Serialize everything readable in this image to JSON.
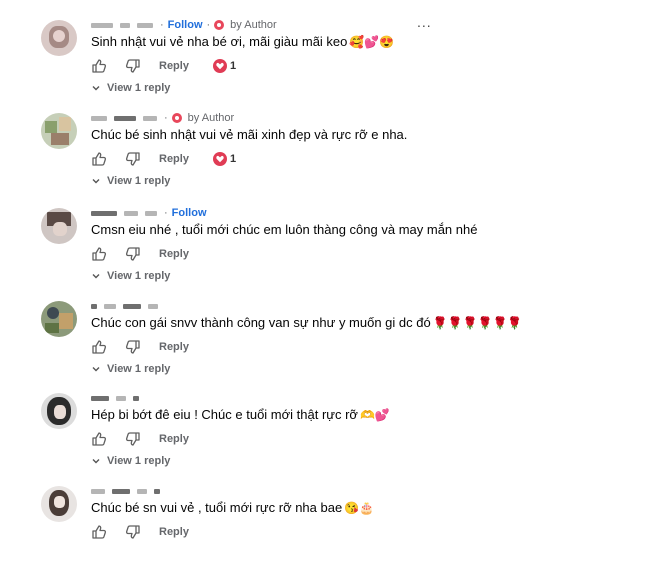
{
  "comments": [
    {
      "follow": "Follow",
      "author_badge": "by Author",
      "text": "Sinh nhật vui vẻ nha bé ơi, mãi giàu mãi keo",
      "emoji": "🥰💕😍",
      "actions": {
        "reply": "Reply",
        "heart_count": "1"
      },
      "view_replies": "View 1 reply"
    },
    {
      "author_badge": "by Author",
      "text": "Chúc bé sinh nhật vui vẻ mãi xinh đẹp và rực rỡ e nha.",
      "emoji": "",
      "actions": {
        "reply": "Reply",
        "heart_count": "1"
      },
      "view_replies": "View 1 reply"
    },
    {
      "follow": "Follow",
      "text": "Cmsn eiu nhé , tuổi mới chúc em luôn thàng công và may mắn nhé",
      "emoji": "",
      "actions": {
        "reply": "Reply"
      },
      "view_replies": "View 1 reply"
    },
    {
      "text": "Chúc con gái snvv thành công van sự như y muốn gi dc đó",
      "emoji": "🌹🌹🌹🌹🌹🌹",
      "actions": {
        "reply": "Reply"
      },
      "view_replies": "View 1 reply"
    },
    {
      "text": "Hép bi bớt đê eiu ! Chúc e tuổi mới thật rực rỡ",
      "emoji": "🫶💕",
      "actions": {
        "reply": "Reply"
      },
      "view_replies": "View 1 reply"
    },
    {
      "text": "Chúc bé sn vui vẻ , tuổi mới rực rỡ nha bae",
      "emoji": "😘🎂",
      "actions": {
        "reply": "Reply"
      }
    }
  ],
  "more_menu_label": "...",
  "colors": {
    "follow": "#216fdb",
    "heart": "#e03c55",
    "author_badge": "#e8475b"
  }
}
